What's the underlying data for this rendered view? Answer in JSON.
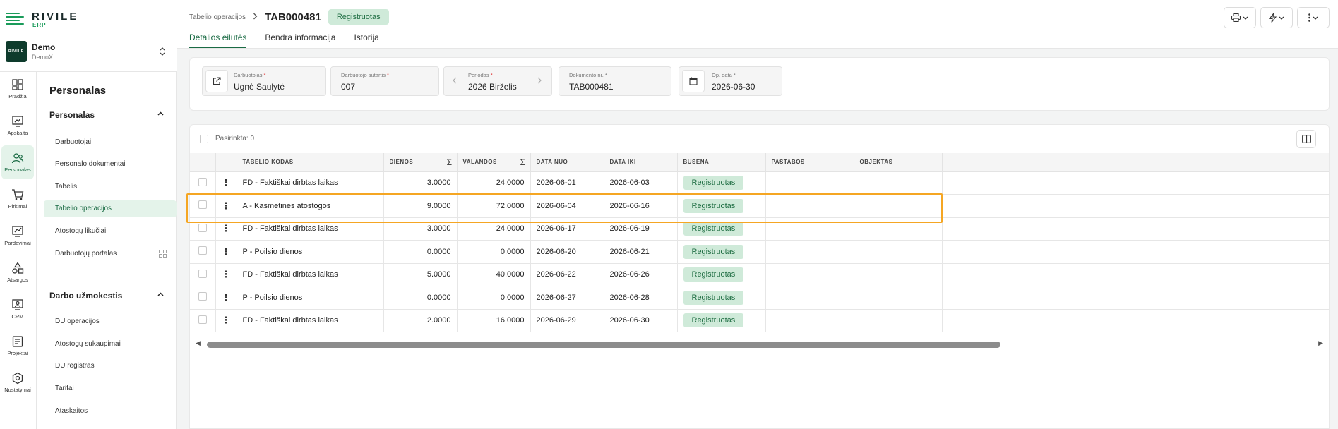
{
  "app": {
    "name": "RIVILE",
    "sub": "ERP"
  },
  "company": {
    "name": "Demo",
    "sub": "DemoX",
    "avatar_text": "RIVILE"
  },
  "rail": [
    {
      "label": "Pradžia",
      "icon": "dashboard-icon"
    },
    {
      "label": "Apskaita",
      "icon": "accounting-icon"
    },
    {
      "label": "Personalas",
      "icon": "people-icon",
      "active": true
    },
    {
      "label": "Pirkimai",
      "icon": "cart-icon"
    },
    {
      "label": "Pardavimai",
      "icon": "sales-icon"
    },
    {
      "label": "Atsargos",
      "icon": "shapes-icon"
    },
    {
      "label": "CRM",
      "icon": "crm-icon"
    },
    {
      "label": "Projektai",
      "icon": "projects-icon"
    },
    {
      "label": "Nustatymai",
      "icon": "settings-icon"
    }
  ],
  "sidebar": {
    "title": "Personalas",
    "group1": {
      "label": "Personalas",
      "items": [
        "Darbuotojai",
        "Personalo dokumentai",
        "Tabelis",
        "Tabelio operacijos",
        "Atostogų likučiai",
        "Darbuotojų portalas"
      ],
      "active_index": 3
    },
    "group2": {
      "label": "Darbo užmokestis",
      "items": [
        "DU operacijos",
        "Atostogų sukaupimai",
        "DU registras",
        "Tarifai",
        "Ataskaitos"
      ]
    }
  },
  "breadcrumb": {
    "parent": "Tabelio operacijos",
    "title": "TAB000481",
    "status": "Registruotas"
  },
  "tabs": [
    "Detalios eilutės",
    "Bendra informacija",
    "Istorija"
  ],
  "form": {
    "employee": {
      "label": "Darbuotojas",
      "value": "Ugnė Saulytė"
    },
    "contract": {
      "label": "Darbuotojo sutartis",
      "value": "007"
    },
    "period": {
      "label": "Periodas",
      "value": "2026 Birželis"
    },
    "doc_no": {
      "label": "Dokumento nr.",
      "value": "TAB000481"
    },
    "op_date": {
      "label": "Op. data",
      "value": "2026-06-30"
    }
  },
  "table": {
    "selected_label": "Pasirinkta: 0",
    "columns": {
      "code": "TABELIO KODAS",
      "days": "DIENOS",
      "hours": "VALANDOS",
      "date_from": "DATA NUO",
      "date_to": "DATA IKI",
      "status": "BŪSENA",
      "notes": "PASTABOS",
      "object": "OBJEKTAS"
    },
    "sigma": "Σ",
    "rows": [
      {
        "code": "FD - Faktiškai dirbtas laikas",
        "days": "3.0000",
        "hours": "24.0000",
        "from": "2026-06-01",
        "to": "2026-06-03",
        "status": "Registruotas",
        "notes": "",
        "object": ""
      },
      {
        "code": "A - Kasmetinės atostogos",
        "days": "9.0000",
        "hours": "72.0000",
        "from": "2026-06-04",
        "to": "2026-06-16",
        "status": "Registruotas",
        "notes": "",
        "object": ""
      },
      {
        "code": "FD - Faktiškai dirbtas laikas",
        "days": "3.0000",
        "hours": "24.0000",
        "from": "2026-06-17",
        "to": "2026-06-19",
        "status": "Registruotas",
        "notes": "",
        "object": ""
      },
      {
        "code": "P - Poilsio dienos",
        "days": "0.0000",
        "hours": "0.0000",
        "from": "2026-06-20",
        "to": "2026-06-21",
        "status": "Registruotas",
        "notes": "",
        "object": ""
      },
      {
        "code": "FD - Faktiškai dirbtas laikas",
        "days": "5.0000",
        "hours": "40.0000",
        "from": "2026-06-22",
        "to": "2026-06-26",
        "status": "Registruotas",
        "notes": "",
        "object": ""
      },
      {
        "code": "P - Poilsio dienos",
        "days": "0.0000",
        "hours": "0.0000",
        "from": "2026-06-27",
        "to": "2026-06-28",
        "status": "Registruotas",
        "notes": "",
        "object": ""
      },
      {
        "code": "FD - Faktiškai dirbtas laikas",
        "days": "2.0000",
        "hours": "16.0000",
        "from": "2026-06-29",
        "to": "2026-06-30",
        "status": "Registruotas",
        "notes": "",
        "object": ""
      }
    ],
    "highlighted_row": 1
  },
  "colors": {
    "accent": "#1a6b44",
    "badge_bg": "#cfead9",
    "highlight": "#f5a623"
  }
}
